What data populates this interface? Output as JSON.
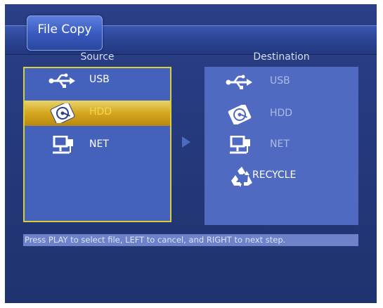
{
  "window": {
    "title": "File Copy"
  },
  "source": {
    "header": "Source",
    "items": [
      {
        "label": "USB",
        "icon": "usb-icon"
      },
      {
        "label": "HDD",
        "icon": "hdd-icon",
        "selected": true
      },
      {
        "label": "NET",
        "icon": "network-icon"
      }
    ]
  },
  "destination": {
    "header": "Destination",
    "items": [
      {
        "label": "USB",
        "icon": "usb-icon"
      },
      {
        "label": "HDD",
        "icon": "hdd-icon"
      },
      {
        "label": "NET",
        "icon": "network-icon"
      },
      {
        "label": "RECYCLE",
        "icon": "recycle-icon"
      }
    ]
  },
  "hint": "Press PLAY to select file, LEFT to cancel, and RIGHT to next step.",
  "colors": {
    "background": "#253a7d",
    "selection": "#d6a61e",
    "source_border": "#d9cf3a",
    "hint_bar": "#6d82c8"
  }
}
